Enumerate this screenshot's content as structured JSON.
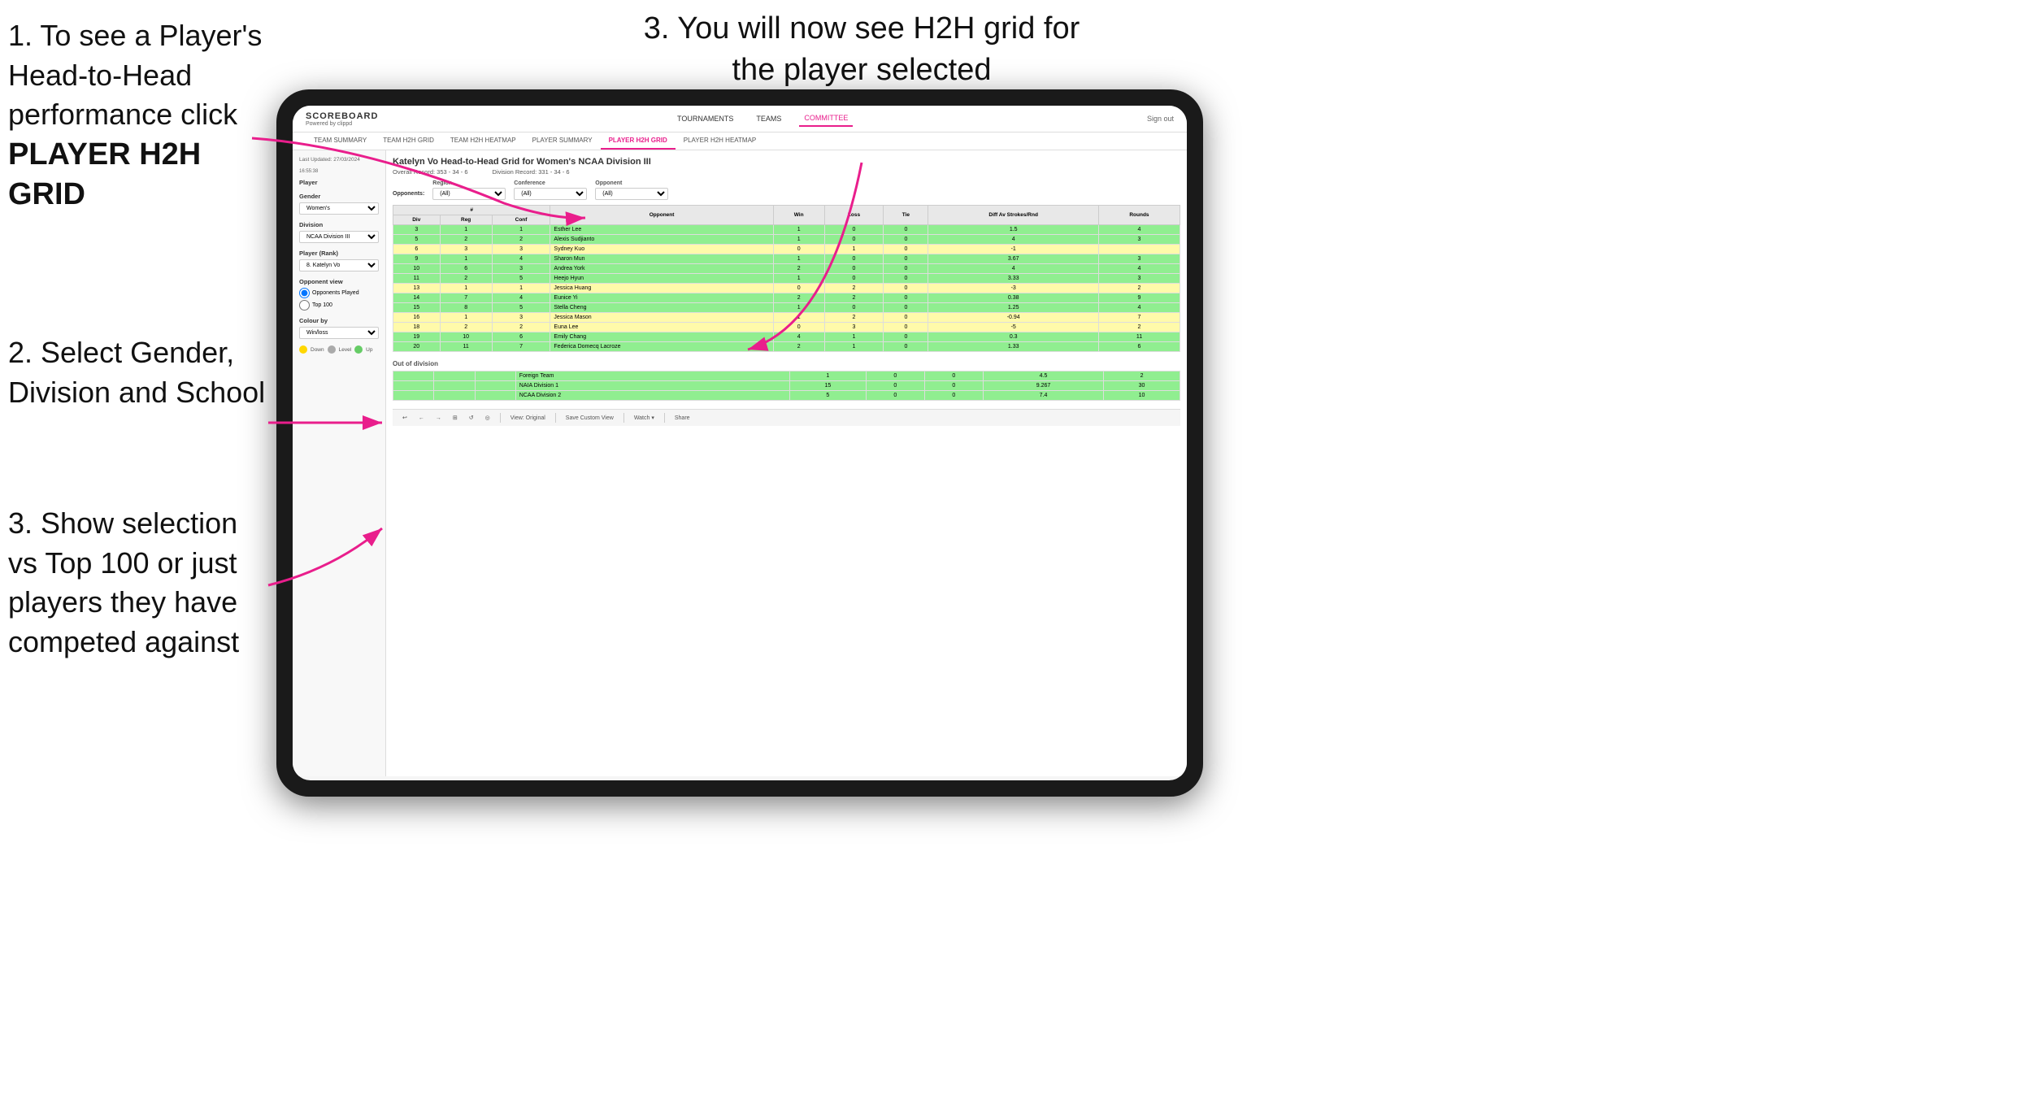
{
  "instructions": {
    "top_left_1": "1. To see a Player's Head-to-Head performance click",
    "top_left_1_bold": "PLAYER H2H GRID",
    "top_right_3": "3. You will now see H2H grid for the player selected",
    "left_2": "2. Select Gender, Division and School",
    "left_3": "3. Show selection vs Top 100 or just players they have competed against"
  },
  "nav": {
    "logo": "SCOREBOARD",
    "logo_sub": "Powered by clippd",
    "links": [
      "TOURNAMENTS",
      "TEAMS",
      "COMMITTEE"
    ],
    "sign_out": "Sign out",
    "sub_links": [
      "TEAM SUMMARY",
      "TEAM H2H GRID",
      "TEAM H2H HEATMAP",
      "PLAYER SUMMARY",
      "PLAYER H2H GRID",
      "PLAYER H2H HEATMAP"
    ]
  },
  "left_panel": {
    "date": "Last Updated: 27/03/2024",
    "time": "16:55:38",
    "player_label": "Player",
    "gender_label": "Gender",
    "gender_value": "Women's",
    "division_label": "Division",
    "division_value": "NCAA Division III",
    "player_rank_label": "Player (Rank)",
    "player_rank_value": "8. Katelyn Vo",
    "opponent_view_label": "Opponent view",
    "radio1": "Opponents Played",
    "radio2": "Top 100",
    "colour_by_label": "Colour by",
    "colour_by_value": "Win/loss",
    "legend": [
      {
        "color": "#FFD700",
        "label": "Down"
      },
      {
        "color": "#aaaaaa",
        "label": "Level"
      },
      {
        "color": "#66cc66",
        "label": "Up"
      }
    ]
  },
  "main": {
    "title": "Katelyn Vo Head-to-Head Grid for Women's NCAA Division III",
    "overall_record": "Overall Record: 353 - 34 - 6",
    "division_record": "Division Record: 331 - 34 - 6",
    "filters": {
      "opponents_label": "Opponents:",
      "region_label": "Region",
      "region_value": "(All)",
      "conference_label": "Conference",
      "conference_value": "(All)",
      "opponent_label": "Opponent",
      "opponent_value": "(All)"
    },
    "table_headers": [
      "#",
      "#",
      "#",
      "Opponent",
      "Win",
      "Loss",
      "Tie",
      "Diff Av Strokes/Rnd",
      "Rounds"
    ],
    "table_sub_headers": [
      "Div",
      "Reg",
      "Conf",
      "",
      "",
      "",
      "",
      "",
      ""
    ],
    "rows": [
      {
        "div": 3,
        "reg": 1,
        "conf": 1,
        "opponent": "Esther Lee",
        "win": 1,
        "loss": 0,
        "tie": 0,
        "diff": 1.5,
        "rounds": 4,
        "color": "green"
      },
      {
        "div": 5,
        "reg": 2,
        "conf": 2,
        "opponent": "Alexis Sudjianto",
        "win": 1,
        "loss": 0,
        "tie": 0,
        "diff": 4.0,
        "rounds": 3,
        "color": "green"
      },
      {
        "div": 6,
        "reg": 3,
        "conf": 3,
        "opponent": "Sydney Kuo",
        "win": 0,
        "loss": 1,
        "tie": 0,
        "diff": -1.0,
        "rounds": "",
        "color": "yellow"
      },
      {
        "div": 9,
        "reg": 1,
        "conf": 4,
        "opponent": "Sharon Mun",
        "win": 1,
        "loss": 0,
        "tie": 0,
        "diff": 3.67,
        "rounds": 3,
        "color": "green"
      },
      {
        "div": 10,
        "reg": 6,
        "conf": 3,
        "opponent": "Andrea York",
        "win": 2,
        "loss": 0,
        "tie": 0,
        "diff": 4.0,
        "rounds": 4,
        "color": "green"
      },
      {
        "div": 11,
        "reg": 2,
        "conf": 5,
        "opponent": "Heejo Hyun",
        "win": 1,
        "loss": 0,
        "tie": 0,
        "diff": 3.33,
        "rounds": 3,
        "color": "green"
      },
      {
        "div": 13,
        "reg": 1,
        "conf": 1,
        "opponent": "Jessica Huang",
        "win": 0,
        "loss": 2,
        "tie": 0,
        "diff": -3.0,
        "rounds": 2,
        "color": "yellow"
      },
      {
        "div": 14,
        "reg": 7,
        "conf": 4,
        "opponent": "Eunice Yi",
        "win": 2,
        "loss": 2,
        "tie": 0,
        "diff": 0.38,
        "rounds": 9,
        "color": "green"
      },
      {
        "div": 15,
        "reg": 8,
        "conf": 5,
        "opponent": "Stella Cheng",
        "win": 1,
        "loss": 0,
        "tie": 0,
        "diff": 1.25,
        "rounds": 4,
        "color": "green"
      },
      {
        "div": 16,
        "reg": 1,
        "conf": 3,
        "opponent": "Jessica Mason",
        "win": 1,
        "loss": 2,
        "tie": 0,
        "diff": -0.94,
        "rounds": 7,
        "color": "yellow"
      },
      {
        "div": 18,
        "reg": 2,
        "conf": 2,
        "opponent": "Euna Lee",
        "win": 0,
        "loss": 3,
        "tie": 0,
        "diff": -5.0,
        "rounds": 2,
        "color": "yellow"
      },
      {
        "div": 19,
        "reg": 10,
        "conf": 6,
        "opponent": "Emily Chang",
        "win": 4,
        "loss": 1,
        "tie": 0,
        "diff": 0.3,
        "rounds": 11,
        "color": "green"
      },
      {
        "div": 20,
        "reg": 11,
        "conf": 7,
        "opponent": "Federica Domecq Lacroze",
        "win": 2,
        "loss": 1,
        "tie": 0,
        "diff": 1.33,
        "rounds": 6,
        "color": "green"
      }
    ],
    "out_of_division_label": "Out of division",
    "out_of_division_rows": [
      {
        "name": "Foreign Team",
        "win": 1,
        "loss": 0,
        "tie": 0,
        "diff": 4.5,
        "rounds": 2,
        "color": "green"
      },
      {
        "name": "NAIA Division 1",
        "win": 15,
        "loss": 0,
        "tie": 0,
        "diff": 9.267,
        "rounds": 30,
        "color": "green"
      },
      {
        "name": "NCAA Division 2",
        "win": 5,
        "loss": 0,
        "tie": 0,
        "diff": 7.4,
        "rounds": 10,
        "color": "green"
      }
    ]
  },
  "toolbar": {
    "buttons": [
      "↩",
      "←",
      "→",
      "⊡",
      "↺",
      "◎"
    ],
    "view_original": "View: Original",
    "save_custom": "Save Custom View",
    "watch": "Watch ▾",
    "share": "Share"
  }
}
